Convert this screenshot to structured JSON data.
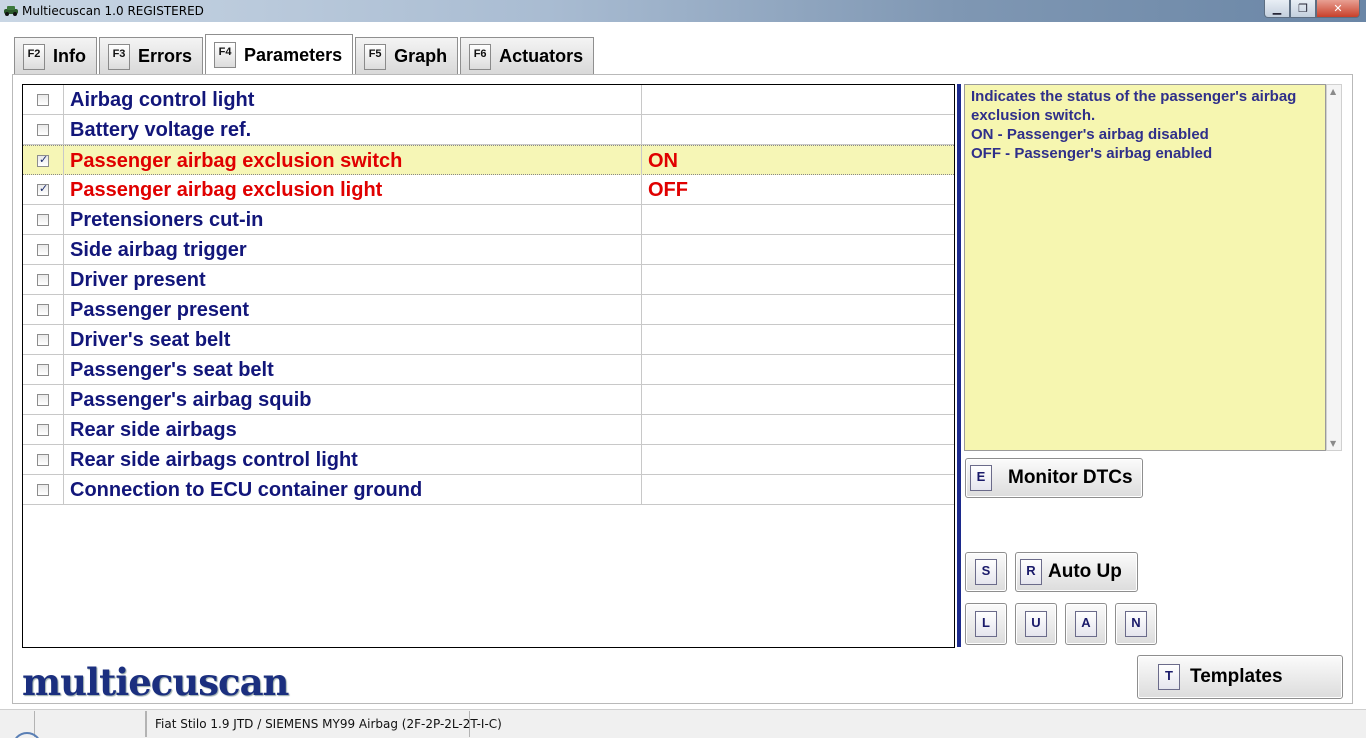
{
  "window": {
    "title": "Multiecuscan 1.0 REGISTERED",
    "min_glyph": "▁",
    "max_glyph": "❐",
    "close_glyph": "✕"
  },
  "tabs": [
    {
      "key": "F2",
      "label": "Info"
    },
    {
      "key": "F3",
      "label": "Errors"
    },
    {
      "key": "F4",
      "label": "Parameters",
      "active": true
    },
    {
      "key": "F5",
      "label": "Graph"
    },
    {
      "key": "F6",
      "label": "Actuators"
    }
  ],
  "parameters": {
    "rows": [
      {
        "name": "Airbag control light",
        "value": "",
        "checked": false
      },
      {
        "name": "Battery voltage ref.",
        "value": "",
        "checked": false
      },
      {
        "name": "Passenger airbag exclusion switch",
        "value": "ON",
        "checked": true,
        "selected": true
      },
      {
        "name": "Passenger airbag exclusion light",
        "value": "OFF",
        "checked": true
      },
      {
        "name": "Pretensioners cut-in",
        "value": "",
        "checked": false
      },
      {
        "name": "Side airbag trigger",
        "value": "",
        "checked": false
      },
      {
        "name": "Driver present",
        "value": "",
        "checked": false
      },
      {
        "name": "Passenger present",
        "value": "",
        "checked": false
      },
      {
        "name": "Driver's seat belt",
        "value": "",
        "checked": false
      },
      {
        "name": "Passenger's seat belt",
        "value": "",
        "checked": false
      },
      {
        "name": "Passenger's airbag squib",
        "value": "",
        "checked": false
      },
      {
        "name": "Rear side airbags",
        "value": "",
        "checked": false
      },
      {
        "name": "Rear side airbags control light",
        "value": "",
        "checked": false
      },
      {
        "name": "Connection to ECU container ground",
        "value": "",
        "checked": false
      }
    ],
    "check_glyph": "✓",
    "highlight_color": "#e00000"
  },
  "description": {
    "lines": [
      "Indicates the status of the passenger's airbag",
      "exclusion switch.",
      "ON - Passenger's airbag disabled",
      "OFF - Passenger's airbag enabled"
    ],
    "scroll_up": "▲",
    "scroll_down": "▼"
  },
  "buttons": {
    "monitor": {
      "key": "E",
      "label": "Monitor DTCs"
    },
    "s": {
      "key": "S"
    },
    "autoup": {
      "key": "R",
      "label": "Auto Up"
    },
    "l": {
      "key": "L"
    },
    "u": {
      "key": "U"
    },
    "a": {
      "key": "A"
    },
    "n": {
      "key": "N"
    },
    "templates": {
      "key": "T",
      "label": "Templates"
    }
  },
  "logo": {
    "text": "multiecuscan"
  },
  "statusbar": {
    "vehicle": "Fiat Stilo 1.9 JTD / SIEMENS MY99 Airbag (2F-2P-2L-2T-I-C)"
  }
}
